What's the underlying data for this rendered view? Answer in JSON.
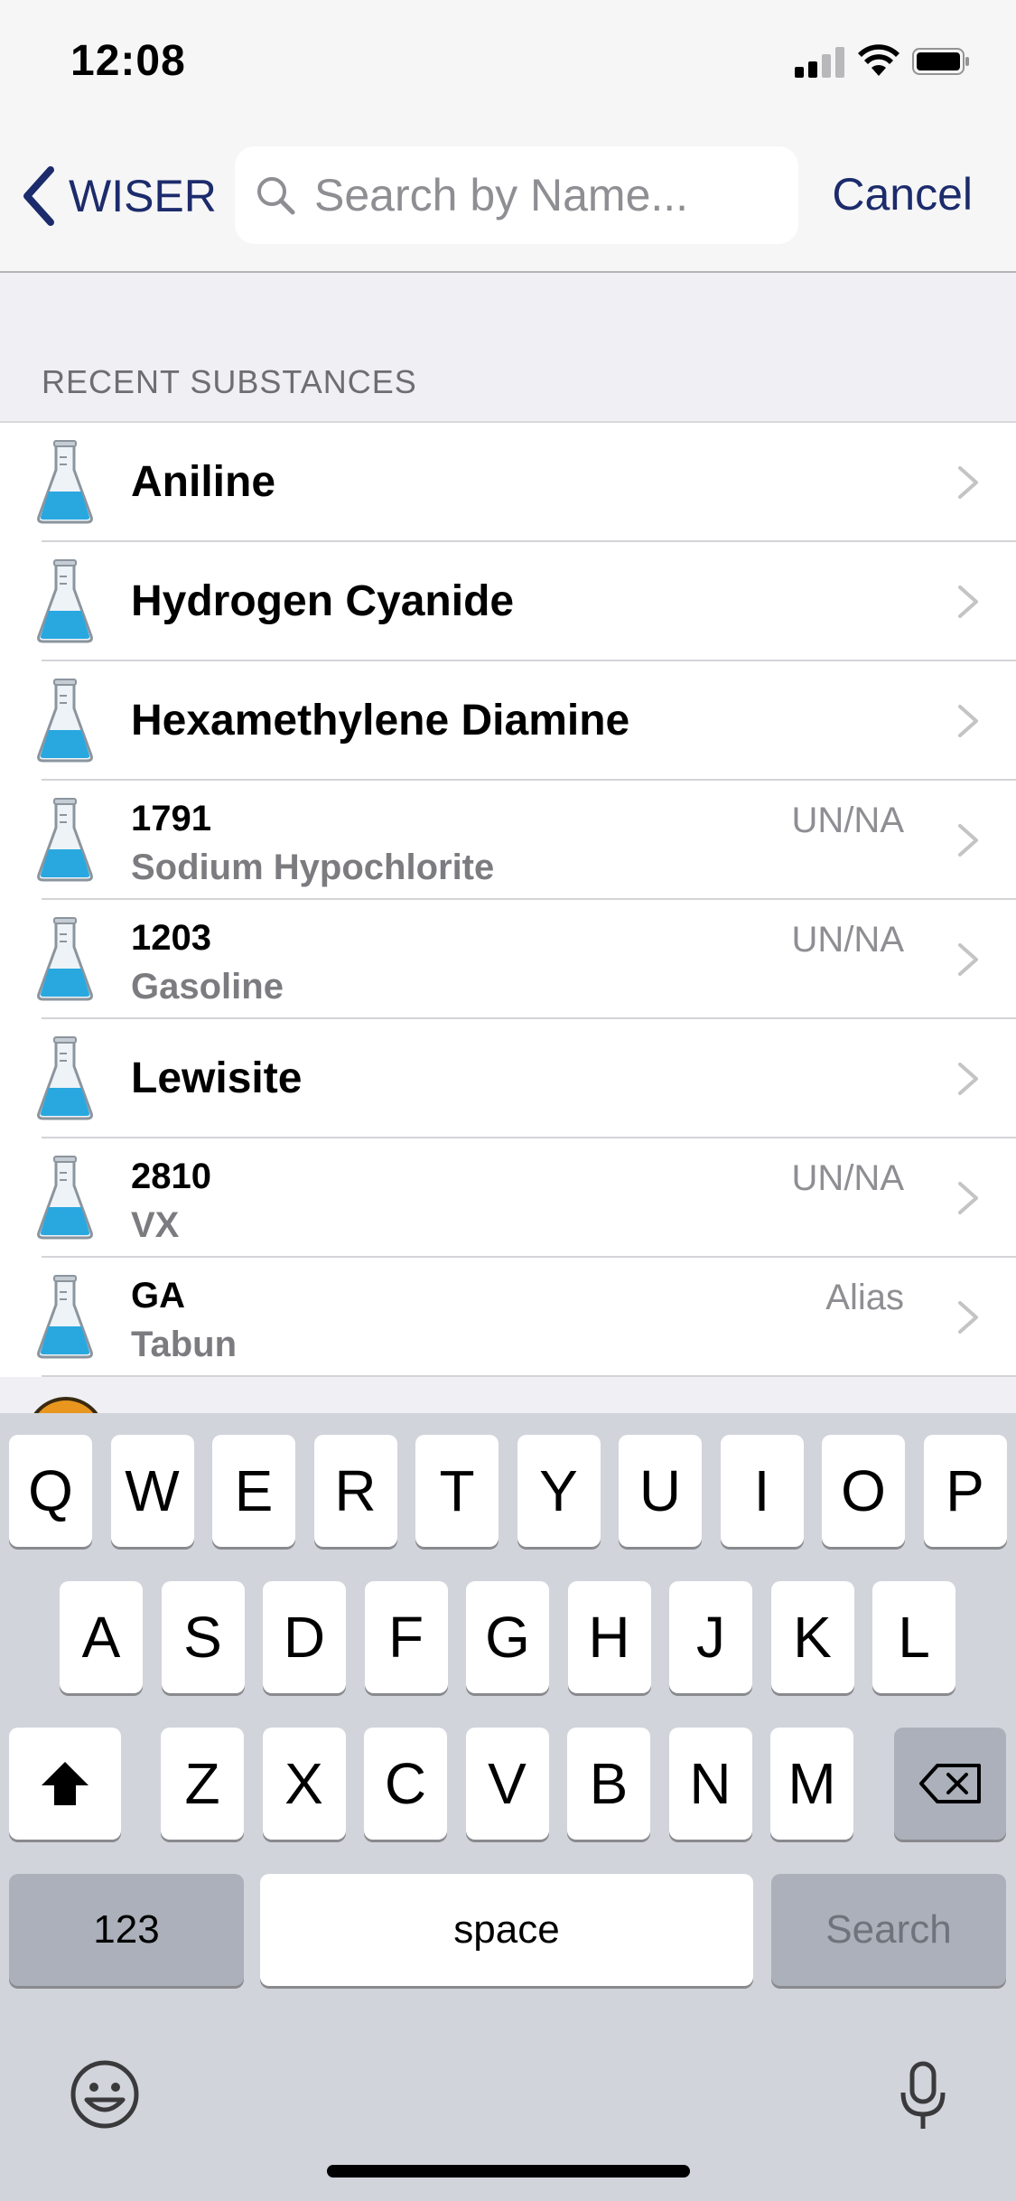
{
  "status_bar": {
    "time": "12:08"
  },
  "nav": {
    "back_label": "WISER",
    "search_placeholder": "Search by Name...",
    "cancel_label": "Cancel"
  },
  "section": {
    "header": "RECENT SUBSTANCES"
  },
  "list": [
    {
      "type": "single",
      "title": "Aniline"
    },
    {
      "type": "single",
      "title": "Hydrogen Cyanide"
    },
    {
      "type": "single",
      "title": "Hexamethylene Diamine"
    },
    {
      "type": "double",
      "title": "1791",
      "subtitle": "Sodium Hypochlorite",
      "tag": "UN/NA"
    },
    {
      "type": "double",
      "title": "1203",
      "subtitle": "Gasoline",
      "tag": "UN/NA"
    },
    {
      "type": "single",
      "title": "Lewisite"
    },
    {
      "type": "double",
      "title": "2810",
      "subtitle": "VX",
      "tag": "UN/NA"
    },
    {
      "type": "double",
      "title": "GA",
      "subtitle": "Tabun",
      "tag": "Alias"
    }
  ],
  "keyboard": {
    "row1": [
      "Q",
      "W",
      "E",
      "R",
      "T",
      "Y",
      "U",
      "I",
      "O",
      "P"
    ],
    "row2": [
      "A",
      "S",
      "D",
      "F",
      "G",
      "H",
      "J",
      "K",
      "L"
    ],
    "row3": [
      "Z",
      "X",
      "C",
      "V",
      "B",
      "N",
      "M"
    ],
    "numbers_label": "123",
    "space_label": "space",
    "search_label": "Search"
  },
  "colors": {
    "accent": "#1c2b6b",
    "flask_liquid": "#29a8e0"
  }
}
